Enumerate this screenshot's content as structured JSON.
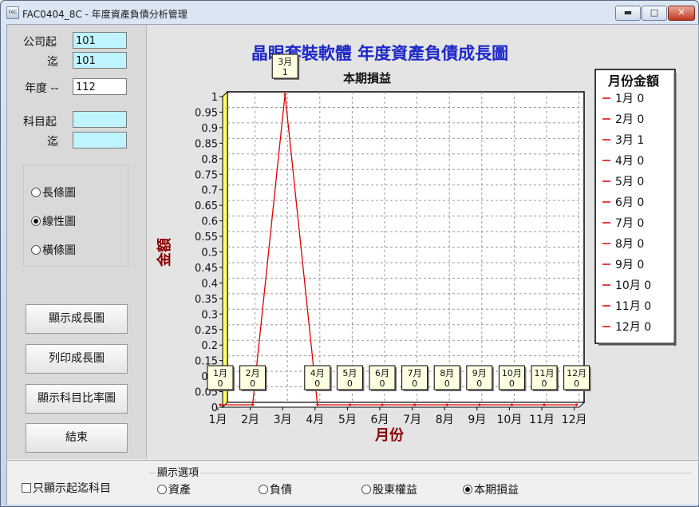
{
  "window": {
    "title": "FAC0404_8C - 年度資產負債分析管理",
    "icon_text": "FAC"
  },
  "filters": {
    "company_from_label": "公司起",
    "company_from": "101",
    "company_to_label": "迄",
    "company_to": "101",
    "year_label": "年度 --",
    "year": "112",
    "subject_from_label": "科目起",
    "subject_from": "",
    "subject_to_label": "迄",
    "subject_to": ""
  },
  "chart_types": [
    {
      "label": "長條圖",
      "selected": false
    },
    {
      "label": "線性圖",
      "selected": true
    },
    {
      "label": "橫條圖",
      "selected": false
    }
  ],
  "buttons": {
    "show": "顯示成長圖",
    "print": "列印成長圖",
    "ratio": "顯示科目比率圖",
    "exit": "結束"
  },
  "bottom": {
    "only_range_label": "只顯示起迄科目",
    "options_title": "顯示選項",
    "options": [
      {
        "label": "資產",
        "selected": false
      },
      {
        "label": "負債",
        "selected": false
      },
      {
        "label": "股東權益",
        "selected": false
      },
      {
        "label": "本期損益",
        "selected": true
      }
    ]
  },
  "colors": {
    "title": "#1e28c8",
    "axis_title": "#8b0000",
    "line": "#e00000",
    "wall": "#ffff66"
  },
  "chart_data": {
    "type": "line",
    "title": "晶眼套裝軟體  年度資產負債成長圖",
    "subtitle": "本期損益",
    "xlabel": "月份",
    "ylabel": "金額",
    "categories": [
      "1月",
      "2月",
      "3月",
      "4月",
      "5月",
      "6月",
      "7月",
      "8月",
      "9月",
      "10月",
      "11月",
      "12月"
    ],
    "y_ticks": [
      "0",
      "0.05",
      "0.1",
      "0.15",
      "0.2",
      "0.25",
      "0.3",
      "0.35",
      "0.4",
      "0.45",
      "0.5",
      "0.55",
      "0.6",
      "0.65",
      "0.7",
      "0.75",
      "0.8",
      "0.85",
      "0.9",
      "0.95",
      "1"
    ],
    "ylim": [
      0,
      1
    ],
    "series": [
      {
        "values": [
          0,
          0,
          1,
          0,
          0,
          0,
          0,
          0,
          0,
          0,
          0,
          0
        ]
      }
    ],
    "grid": true,
    "legend_title": "月份金額",
    "legend": [
      "1月  0",
      "2月  0",
      "3月  1",
      "4月  0",
      "5月  0",
      "6月  0",
      "7月  0",
      "8月  0",
      "9月  0",
      "10月 0",
      "11月 0",
      "12月 0"
    ],
    "legend_position": "right"
  }
}
